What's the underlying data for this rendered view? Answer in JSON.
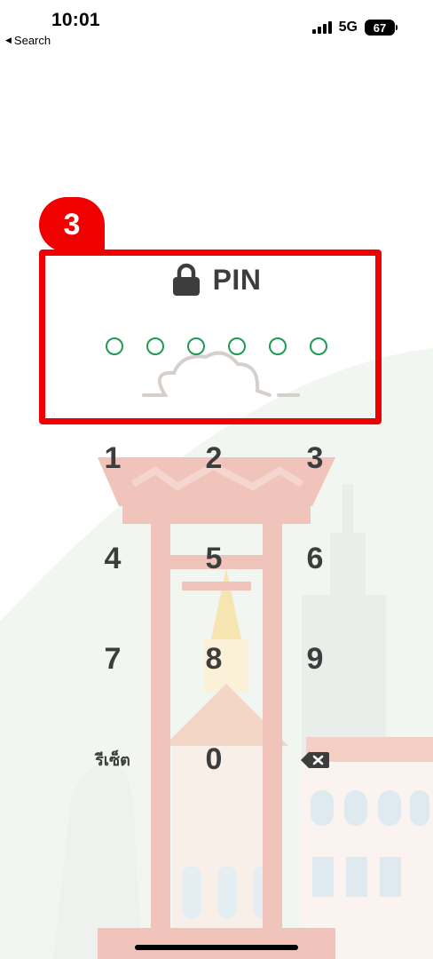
{
  "status_bar": {
    "time": "10:01",
    "back_label": "Search",
    "network": "5G",
    "battery": "67"
  },
  "pin": {
    "title": "PIN",
    "length": 6,
    "entered": 0
  },
  "annotation": {
    "step": "3"
  },
  "keypad": {
    "keys": [
      "1",
      "2",
      "3",
      "4",
      "5",
      "6",
      "7",
      "8",
      "9"
    ],
    "reset_label": "รีเซ็ต",
    "zero": "0"
  },
  "colors": {
    "accent": "#1f9a54",
    "annotation": "#f00000",
    "text": "#3d3d3d"
  },
  "icons": {
    "lock": "lock-icon",
    "backspace": "backspace-icon"
  }
}
